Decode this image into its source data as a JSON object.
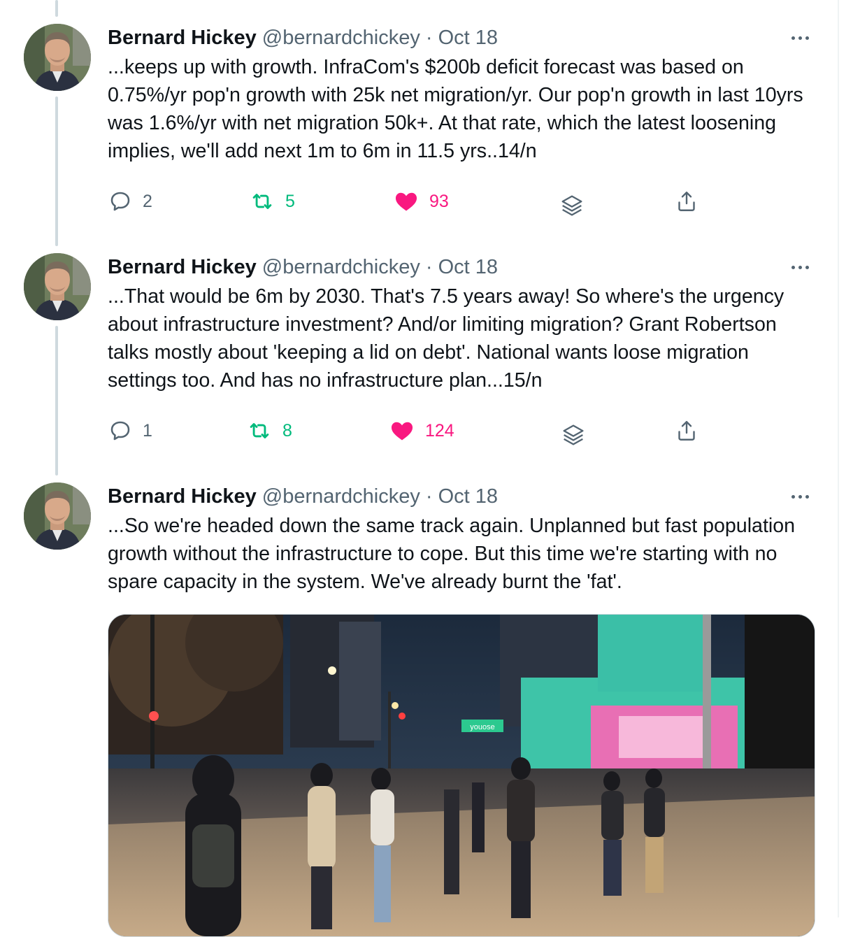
{
  "tweets": [
    {
      "name": "Bernard Hickey",
      "handle": "@bernardchickey",
      "separator": "·",
      "date": "Oct 18",
      "text": "...keeps up with growth. InfraCom's $200b deficit forecast was based on 0.75%/yr pop'n growth with 25k net migration/yr. Our pop'n growth in last 10yrs was 1.6%/yr with net migration 50k+. At that rate, which the latest loosening implies, we'll add next 1m to 6m in 11.5 yrs..14/n",
      "replies": "2",
      "retweets": "5",
      "likes": "93"
    },
    {
      "name": "Bernard Hickey",
      "handle": "@bernardchickey",
      "separator": "·",
      "date": "Oct 18",
      "text": "...That would be 6m by 2030. That's 7.5 years away! So where's the urgency about infrastructure investment? And/or limiting migration? Grant Robertson talks mostly about 'keeping a lid on debt'. National wants loose migration settings too. And has no infrastructure plan...15/n",
      "replies": "1",
      "retweets": "8",
      "likes": "124"
    },
    {
      "name": "Bernard Hickey",
      "handle": "@bernardchickey",
      "separator": "·",
      "date": "Oct 18",
      "text": "...So we're headed down the same track again. Unplanned but fast population growth without the infrastructure to cope. But this time we're starting with no spare capacity in the system. We've already burnt the 'fat'."
    }
  ],
  "media": {
    "sign_text": "youose"
  },
  "icons": {
    "reply": "reply-bubble-icon",
    "retweet": "retweet-icon",
    "like": "heart-icon",
    "stack": "layers-icon",
    "share": "share-upload-icon",
    "more": "more-dots-icon"
  },
  "colors": {
    "text": "#0f1419",
    "secondary": "#536471",
    "retweet": "#00ba7c",
    "like": "#f91880",
    "thread_line": "#cfd9de"
  }
}
